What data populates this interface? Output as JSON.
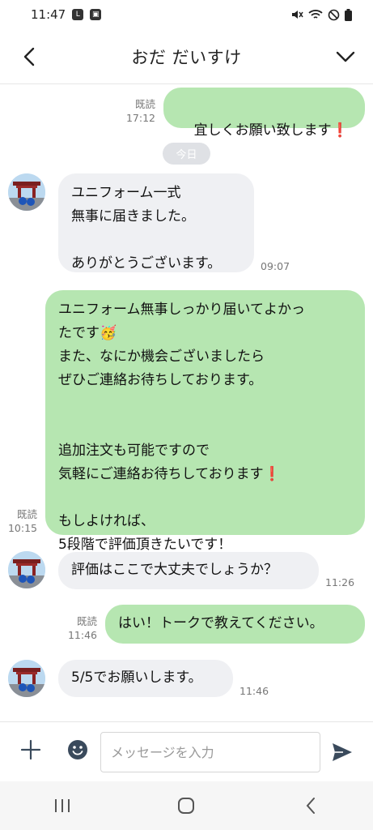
{
  "status_bar": {
    "time": "11:47"
  },
  "header": {
    "title": "おだ だいすけ"
  },
  "chat": {
    "date_divider": "今日",
    "messages": [
      {
        "direction": "out",
        "text": "宜しくお願い致します",
        "read_label": "既読",
        "time": "17:12"
      },
      {
        "direction": "in",
        "text": "ユニフォーム一式\n無事に届きました。\n\nありがとうございます。",
        "time": "09:07"
      },
      {
        "direction": "out",
        "text_part1": "ユニフォーム無事しっかり届いてよかっ\nたです",
        "text_part2": "\nまた、なにか機会ございましたら\nぜひご連絡お待ちしております。\n\n\n追加注文も可能ですので\n気軽にご連絡お待ちしております",
        "text_part3": "\n\nもしよければ、\n5段階で評価頂きたいです！",
        "read_label": "既読",
        "time": "10:15"
      },
      {
        "direction": "in",
        "text": "評価はここで大丈夫でしょうか？",
        "time": "11:26"
      },
      {
        "direction": "out",
        "text": "はい！トークで教えてください。",
        "read_label": "既読",
        "time": "11:46"
      },
      {
        "direction": "in",
        "text": "5/5でお願いします。",
        "time": "11:46"
      }
    ]
  },
  "input_bar": {
    "placeholder": "メッセージを入力"
  },
  "colors": {
    "outgoing_bubble": "#b6e6b1",
    "incoming_bubble": "#eff0f3"
  }
}
